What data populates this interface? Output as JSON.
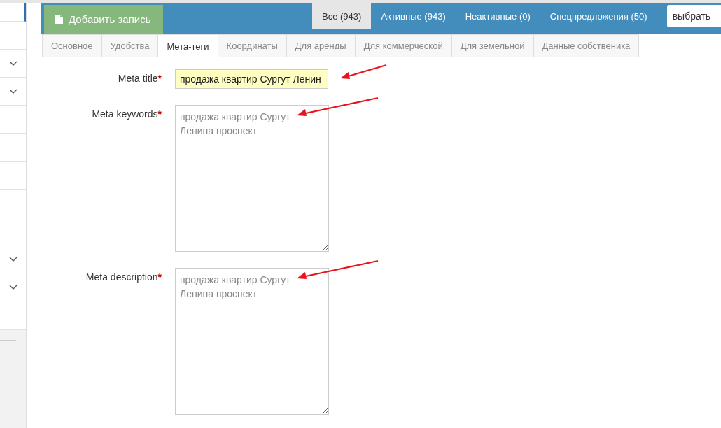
{
  "sidebar": {
    "items": [
      {
        "selected": true,
        "submenu": false
      },
      {
        "selected": false,
        "submenu": false
      },
      {
        "selected": false,
        "submenu": true
      },
      {
        "selected": false,
        "submenu": true
      },
      {
        "selected": false,
        "submenu": false
      },
      {
        "selected": false,
        "submenu": false
      },
      {
        "selected": false,
        "submenu": false
      },
      {
        "selected": false,
        "submenu": false
      },
      {
        "selected": false,
        "submenu": false
      },
      {
        "selected": false,
        "submenu": true
      },
      {
        "selected": false,
        "submenu": true
      },
      {
        "selected": false,
        "submenu": false
      }
    ]
  },
  "toolbar": {
    "add_button": "Добавить запись",
    "filters": [
      {
        "label": "Все (943)",
        "selected": true
      },
      {
        "label": "Активные (943)",
        "selected": false
      },
      {
        "label": "Неактивные (0)",
        "selected": false
      },
      {
        "label": "Спецпредложения (50)",
        "selected": false
      }
    ],
    "select": {
      "value": "выбрать"
    }
  },
  "tabs": [
    {
      "label": "Основное",
      "selected": false
    },
    {
      "label": "Удобства",
      "selected": false
    },
    {
      "label": "Мета-теги",
      "selected": true
    },
    {
      "label": "Координаты",
      "selected": false
    },
    {
      "label": "Для аренды",
      "selected": false
    },
    {
      "label": "Для коммерческой",
      "selected": false
    },
    {
      "label": "Для земельной",
      "selected": false
    },
    {
      "label": "Данные собственика",
      "selected": false
    }
  ],
  "fields": [
    {
      "kind": "input",
      "label": "Meta title",
      "required_mark": "*",
      "value": "продажа квартир Сургут Ленин",
      "highlighted": true,
      "marked": true
    },
    {
      "kind": "textarea",
      "label": "Meta keywords",
      "required_mark": "*",
      "placeholder": "продажа квартир Сургут Ленина проспект",
      "marked": true
    },
    {
      "kind": "textarea",
      "label": "Meta description",
      "required_mark": "*",
      "placeholder": "продажа квартир Сургут Ленина проспект",
      "marked": true
    }
  ]
}
